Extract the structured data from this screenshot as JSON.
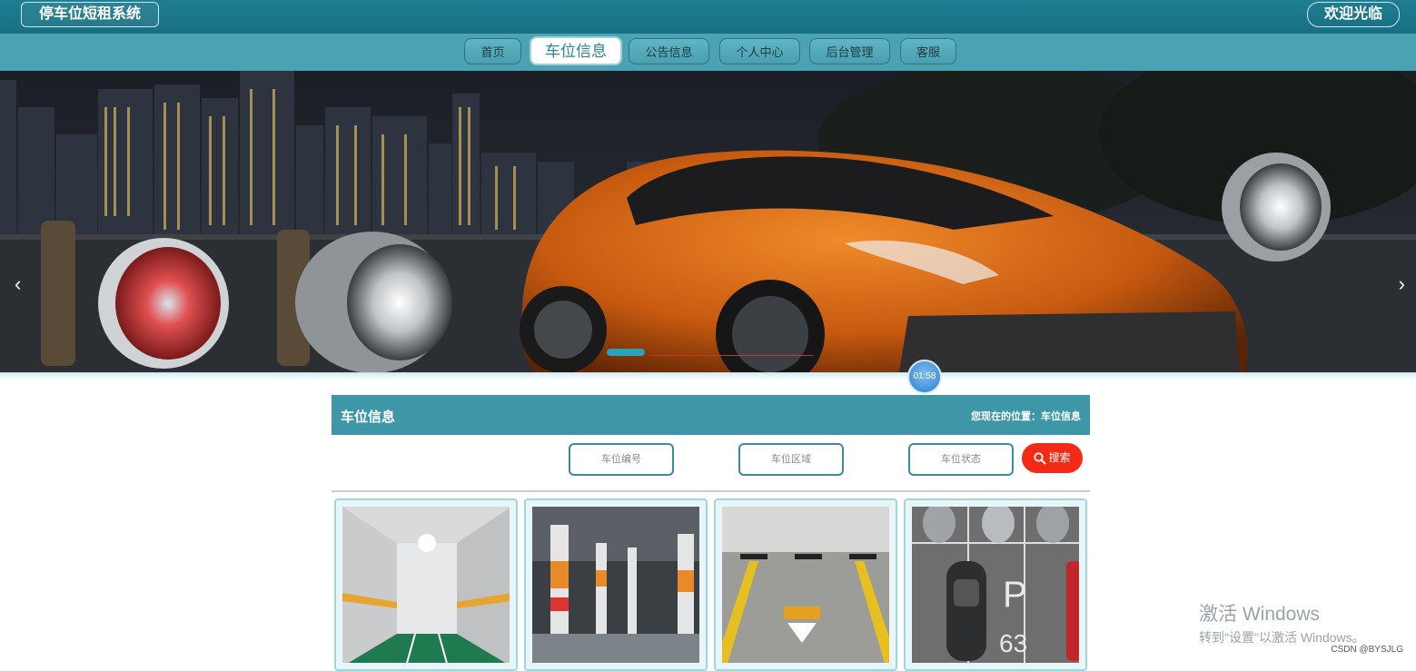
{
  "header": {
    "site_title": "停车位短租系统",
    "welcome": "欢迎光临"
  },
  "nav": {
    "items": [
      {
        "label": "首页"
      },
      {
        "label": "车位信息",
        "active": true
      },
      {
        "label": "公告信息"
      },
      {
        "label": "个人中心"
      },
      {
        "label": "后台管理"
      },
      {
        "label": "客服"
      }
    ]
  },
  "banner": {
    "prev_icon": "‹",
    "next_icon": "›",
    "timer": "01:58"
  },
  "section": {
    "title": "车位信息",
    "breadcrumb": "您现在的位置：车位信息"
  },
  "filters": {
    "spot_number_placeholder": "车位编号",
    "area_placeholder": "车位区域",
    "status_placeholder": "车位状态",
    "search_label": "搜索"
  },
  "cards": [
    {
      "icon": "parking-corridor-photo"
    },
    {
      "icon": "parking-garage-photo"
    },
    {
      "icon": "parking-bay-photo"
    },
    {
      "icon": "parking-lot-aerial-photo"
    }
  ],
  "overlay": {
    "watermark_line1": "激活 Windows",
    "watermark_line2": "转到\"设置\"以激活 Windows。",
    "csdn": "CSDN @BYSJLG"
  },
  "colors": {
    "topbar": "#1f7e91",
    "nav": "#4aa3b3",
    "section_header": "#3d97a6",
    "search_button": "#f22a16"
  }
}
